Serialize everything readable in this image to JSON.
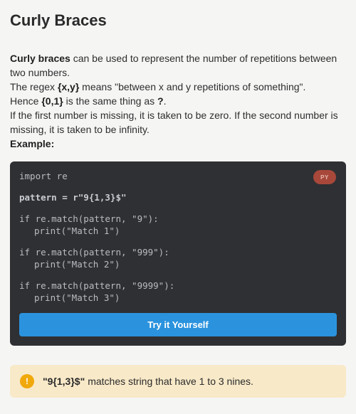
{
  "lesson": {
    "title": "Curly Braces",
    "intro": {
      "p1_bold": "Curly braces",
      "p1_rest": " can be used to represent the number of repetitions between two numbers.",
      "p2_pre": "The regex ",
      "p2_bold": "{x,y}",
      "p2_post": " means \"between x and y repetitions of something\".",
      "p3_pre": "Hence ",
      "p3_bold1": "{0,1}",
      "p3_mid": " is the same thing as ",
      "p3_bold2": "?",
      "p3_post": ".",
      "p4": "If the first number is missing, it is taken to be zero. If the second number is missing, it is taken to be infinity.",
      "example_label": "Example:"
    }
  },
  "code_block": {
    "language_badge": "PY",
    "lines": {
      "import": "import re",
      "pattern": "pattern = r\"9{1,3}$\"",
      "if1": "if re.match(pattern, \"9\"):",
      "print1": "print(\"Match 1\")",
      "if2": "if re.match(pattern, \"999\"):",
      "print2": "print(\"Match 2\")",
      "if3": "if re.match(pattern, \"9999\"):",
      "print3": "print(\"Match 3\")"
    },
    "try_button_label": "Try it Yourself"
  },
  "note": {
    "icon_glyph": "!",
    "bold": "\"9{1,3}$\"",
    "text": "matches string that have 1 to 3 nines."
  },
  "colors": {
    "page_bg": "#f5f5f4",
    "code_bg": "#2f3033",
    "button_accent": "#2b93de",
    "badge_bg": "#a8483b",
    "note_bg": "#f8e9c8",
    "note_icon": "#f0a80b"
  }
}
